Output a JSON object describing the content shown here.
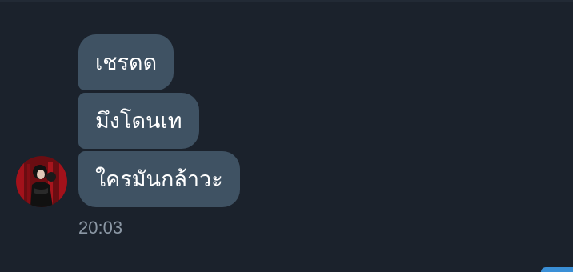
{
  "chat": {
    "messages": [
      {
        "text": "เชรดด"
      },
      {
        "text": "มึงโดนเท"
      },
      {
        "text": "ใครมันกล้าวะ"
      }
    ],
    "timestamp": "20:03"
  },
  "avatar": {
    "icon": "user-avatar",
    "colors": {
      "frame": "#a3121b",
      "background": "#6b0d12",
      "figure": "#111111",
      "skin": "#e2c8b8"
    }
  },
  "theme": {
    "background": "#1b222c",
    "bubble": "#3f5263",
    "text": "#ffffff",
    "timestamp": "#8b97a4",
    "accent": "#3a8fd6"
  }
}
